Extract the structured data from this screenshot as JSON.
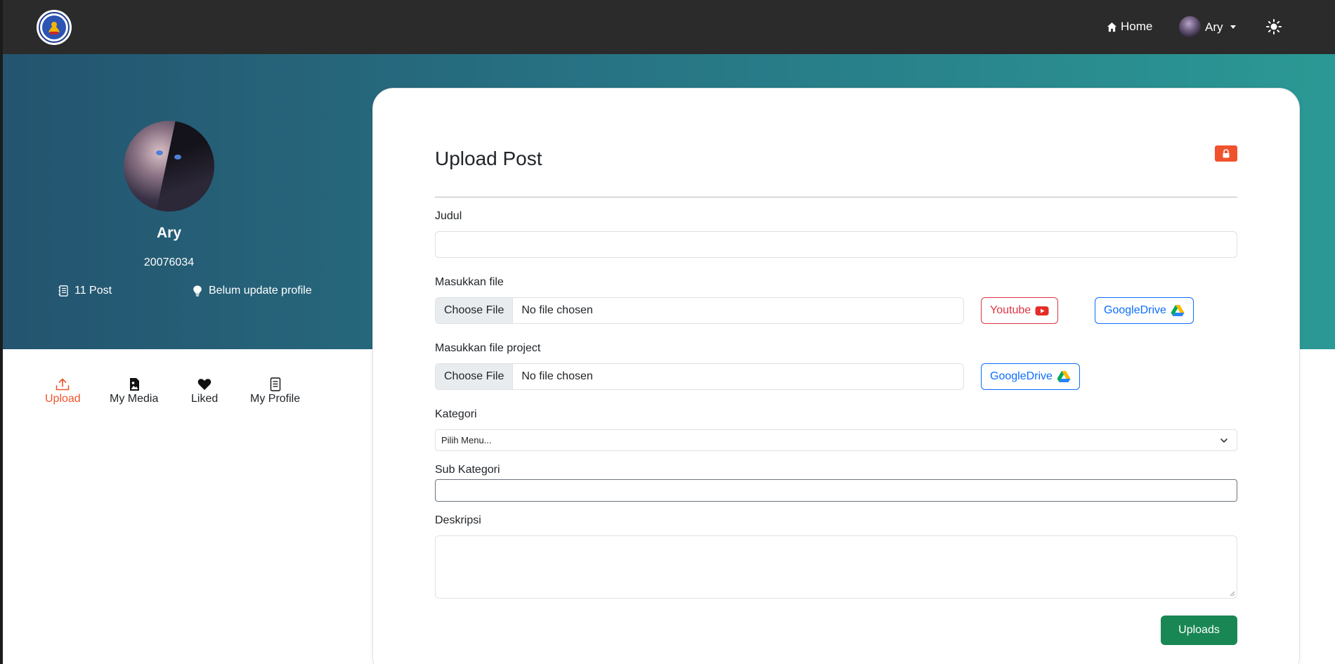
{
  "navbar": {
    "home_label": "Home",
    "user_name": "Ary"
  },
  "profile": {
    "name": "Ary",
    "id_number": "20076034",
    "posts_label": "11 Post",
    "status_label": "Belum update profile"
  },
  "side_tabs": [
    {
      "label": "Upload",
      "icon": "upload-icon",
      "active": true
    },
    {
      "label": "My Media",
      "icon": "image-icon",
      "active": false
    },
    {
      "label": "Liked",
      "icon": "heart-icon",
      "active": false
    },
    {
      "label": "My Profile",
      "icon": "document-icon",
      "active": false
    }
  ],
  "form": {
    "title": "Upload Post",
    "judul_label": "Judul",
    "judul_value": "",
    "file_label": "Masukkan file",
    "file_button": "Choose File",
    "file_status": "No file chosen",
    "youtube_label": "Youtube",
    "gdrive_label": "GoogleDrive",
    "project_label": "Masukkan file project",
    "project_button": "Choose File",
    "project_status": "No file chosen",
    "project_gdrive_label": "GoogleDrive",
    "kategori_label": "Kategori",
    "kategori_selected": "Pilih Menu...",
    "subkategori_label": "Sub Kategori",
    "subkategori_value": "",
    "deskripsi_label": "Deskripsi",
    "deskripsi_value": "",
    "submit_label": "Uploads"
  },
  "colors": {
    "accent_orange": "#f0532c",
    "youtube_red": "#dc3545",
    "link_blue": "#0d6efd",
    "submit_green": "#198754",
    "navbar": "#2b2b2b",
    "hero_start": "#24546f",
    "hero_end": "#2b9995"
  }
}
